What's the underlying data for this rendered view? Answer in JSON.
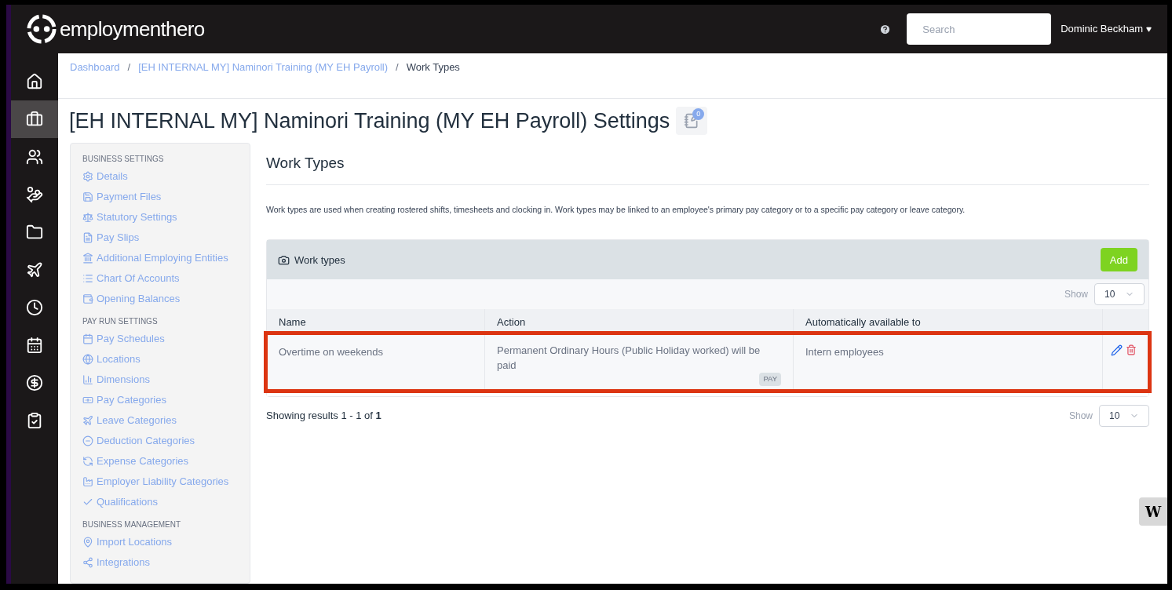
{
  "brand": {
    "name": "employmenthero"
  },
  "header": {
    "search": {
      "placeholder": "Search"
    },
    "user": "Dominic Beckham"
  },
  "nav_rail": [
    {
      "selected": false
    },
    {
      "selected": true
    },
    {
      "selected": false
    },
    {
      "selected": false
    },
    {
      "selected": false
    },
    {
      "selected": false
    },
    {
      "selected": false
    },
    {
      "selected": false
    },
    {
      "selected": false
    },
    {
      "selected": false
    }
  ],
  "breadcrumb_separator": "/",
  "breadcrumbs": [
    {
      "label": "Dashboard",
      "link": true
    },
    {
      "label": "[EH INTERNAL MY] Naminori Training (MY EH Payroll)",
      "link": true
    },
    {
      "label": "Work Types",
      "link": false
    }
  ],
  "page_title": "[EH INTERNAL MY] Naminori Training (MY EH Payroll) Settings",
  "notes_badge": "0",
  "settings_menu": [
    {
      "heading": "BUSINESS SETTINGS",
      "items": [
        "Details",
        "Payment Files",
        "Statutory Settings",
        "Pay Slips",
        "Additional Employing Entities",
        "Chart Of Accounts",
        "Opening Balances"
      ]
    },
    {
      "heading": "PAY RUN SETTINGS",
      "items": [
        "Pay Schedules",
        "Locations",
        "Dimensions",
        "Pay Categories",
        "Leave Categories",
        "Deduction Categories",
        "Expense Categories",
        "Employer Liability Categories",
        "Qualifications"
      ]
    },
    {
      "heading": "BUSINESS MANAGEMENT",
      "items": [
        "Import Locations",
        "Integrations"
      ]
    }
  ],
  "section": {
    "title": "Work Types",
    "description": "Work types are used when creating rostered shifts, timesheets and clocking in. Work types may be linked to an employee's primary pay category or to a specific pay category or leave category."
  },
  "panel": {
    "title": "Work types",
    "add_button": "Add",
    "show_label": "Show",
    "page_size": "10",
    "columns": [
      "Name",
      "Action",
      "Automatically available to"
    ],
    "rows": [
      {
        "name": "Overtime on weekends",
        "action": "Permanent Ordinary Hours (Public Holiday worked) will be paid",
        "tag": "PAY",
        "available_to": "Intern employees",
        "highlighted": true
      }
    ]
  },
  "results": "Showing results 1 - 1 of **1**",
  "footer_show": {
    "label": "Show",
    "page_size": "10"
  },
  "widget": {
    "label": "W"
  }
}
